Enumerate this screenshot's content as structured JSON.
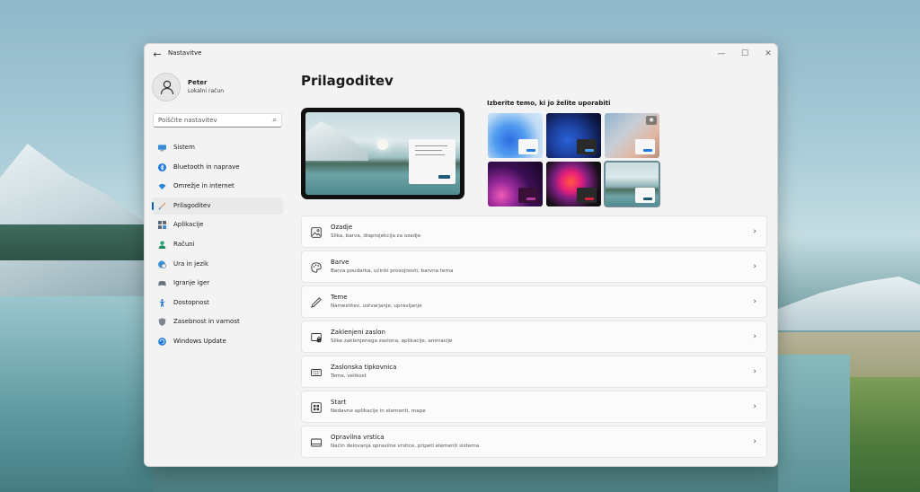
{
  "window": {
    "title": "Nastavitve",
    "back_glyph": "←",
    "minimize_glyph": "—",
    "maximize_glyph": "☐",
    "close_glyph": "✕"
  },
  "user": {
    "name": "Peter",
    "account_type": "Lokalni račun"
  },
  "search": {
    "placeholder": "Poiščite nastavitev"
  },
  "nav": {
    "items": [
      {
        "label": "Sistem",
        "icon": "monitor-icon"
      },
      {
        "label": "Bluetooth in naprave",
        "icon": "bluetooth-icon"
      },
      {
        "label": "Omrežje in internet",
        "icon": "wifi-icon"
      },
      {
        "label": "Prilagoditev",
        "icon": "brush-icon",
        "active": true
      },
      {
        "label": "Aplikacije",
        "icon": "apps-icon"
      },
      {
        "label": "Računi",
        "icon": "person-icon"
      },
      {
        "label": "Ura in jezik",
        "icon": "globe-clock-icon"
      },
      {
        "label": "Igranje iger",
        "icon": "gamepad-icon"
      },
      {
        "label": "Dostopnost",
        "icon": "accessibility-icon"
      },
      {
        "label": "Zasebnost in varnost",
        "icon": "shield-icon"
      },
      {
        "label": "Windows Update",
        "icon": "update-icon"
      }
    ]
  },
  "main": {
    "title": "Prilagoditev",
    "theme_heading": "Izberite temo, ki jo želite uporabiti",
    "themes": [
      {
        "id": "windows-light",
        "selected": false
      },
      {
        "id": "windows-dark",
        "selected": false
      },
      {
        "id": "spotlight",
        "selected": false
      },
      {
        "id": "glow",
        "selected": false
      },
      {
        "id": "captured-motion",
        "selected": false
      },
      {
        "id": "flow",
        "selected": true
      }
    ],
    "cards": [
      {
        "title": "Ozadje",
        "subtitle": "Slika, barva, diaprojekcija za ozadje",
        "icon": "picture-icon"
      },
      {
        "title": "Barve",
        "subtitle": "Barva poudarka, učinki prosojnosti, barvna tema",
        "icon": "palette-icon"
      },
      {
        "title": "Teme",
        "subtitle": "Namestitev, ustvarjanje, upravljanje",
        "icon": "pen-icon"
      },
      {
        "title": "Zaklenjeni zaslon",
        "subtitle": "Slike zaklenjenega zaslona, aplikacije, animacije",
        "icon": "lock-screen-icon"
      },
      {
        "title": "Zaslonska tipkovnica",
        "subtitle": "Teme, velikost",
        "icon": "keyboard-icon"
      },
      {
        "title": "Start",
        "subtitle": "Nedavne aplikacije in elementi, mape",
        "icon": "start-icon"
      },
      {
        "title": "Opravilna vrstica",
        "subtitle": "Način delovanja opravilne vrstice, pripeti elementi sistema",
        "icon": "taskbar-icon"
      }
    ]
  },
  "colors": {
    "accent": "#005fb8",
    "window_bg": "#f3f3f3",
    "card_bg": "#fbfbfb"
  }
}
